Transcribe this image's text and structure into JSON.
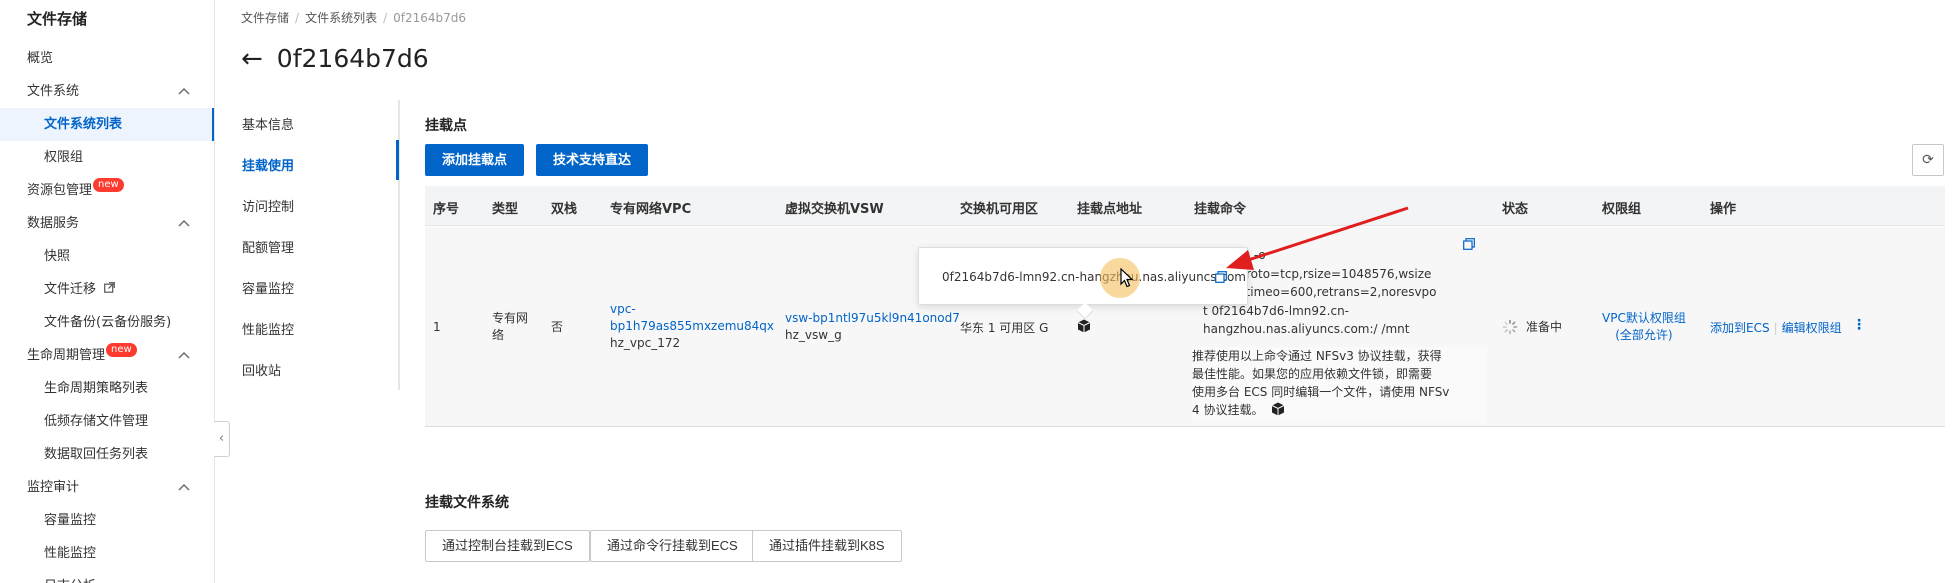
{
  "sidebar": {
    "title": "文件存储",
    "items": [
      {
        "label": "概览"
      },
      {
        "label": "文件系统"
      },
      {
        "label": "文件系统列表"
      },
      {
        "label": "权限组"
      },
      {
        "label": "资源包管理",
        "badge": "new"
      },
      {
        "label": "数据服务"
      },
      {
        "label": "快照"
      },
      {
        "label": "文件迁移"
      },
      {
        "label": "文件备份(云备份服务)"
      },
      {
        "label": "生命周期管理",
        "badge": "new"
      },
      {
        "label": "生命周期策略列表"
      },
      {
        "label": "低频存储文件管理"
      },
      {
        "label": "数据取回任务列表"
      },
      {
        "label": "监控审计"
      },
      {
        "label": "容量监控"
      },
      {
        "label": "性能监控"
      },
      {
        "label": "日志分析"
      }
    ],
    "collapse_glyph": "‹"
  },
  "breadcrumb": [
    "文件存储",
    "文件系统列表",
    "0f2164b7d6"
  ],
  "breadcrumb_sep": "/",
  "page": {
    "title": "0f2164b7d6",
    "back_glyph": "←"
  },
  "inner_nav": [
    {
      "label": "基本信息"
    },
    {
      "label": "挂载使用",
      "active": true
    },
    {
      "label": "访问控制"
    },
    {
      "label": "配额管理"
    },
    {
      "label": "容量监控"
    },
    {
      "label": "性能监控"
    },
    {
      "label": "回收站"
    }
  ],
  "mount": {
    "title": "挂载点",
    "add_button": "添加挂载点",
    "support_button": "技术支持直达",
    "refresh_glyph": "⟳",
    "columns": [
      "序号",
      "类型",
      "双栈",
      "专有网络VPC",
      "虚拟交换机VSW",
      "交换机可用区",
      "挂载点地址",
      "挂载命令",
      "状态",
      "权限组",
      "操作"
    ],
    "row": {
      "index": "1",
      "type_line1": "专有网",
      "type_line2": "络",
      "dual_stack": "否",
      "vpc_line1": "vpc-",
      "vpc_line2": "bp1h79as855mxzemu84qx",
      "vpc_name": "hz_vpc_172",
      "vsw": "vsw-bp1ntl97u5kl9n41onod7",
      "vsw_name": "hz_vsw_g",
      "zone": "华东 1 可用区 G",
      "cmd_lines": [
        "nt -t nfs -o",
        "olock,proto=tcp,rsize=1048576,wsize",
        "6,hard,timeo=600,retrans=2,noresvpo",
        "t 0f2164b7d6-lmn92.cn-",
        "hangzhou.nas.aliyuncs.com:/ /mnt"
      ],
      "note_lines": [
        "推荐使用以上命令通过 NFSv3 协议挂载，获得",
        "最佳性能。如果您的应用依赖文件锁，即需要",
        "使用多台 ECS 同时编辑一个文件，请使用 NFSv",
        "4 协议挂载。"
      ],
      "status": "准备中",
      "perm_line1": "VPC默认权限组",
      "perm_line2": "(全部允许)",
      "action_add_ecs": "添加到ECS",
      "action_edit": "编辑权限组",
      "action_sep": "|",
      "more_glyph": "⋮"
    },
    "tooltip_text": "0f2164b7d6-lmn92.cn-hangzhou.nas.aliyuncs.com"
  },
  "mount_fs": {
    "title": "挂载文件系统",
    "buttons": [
      "通过控制台挂载到ECS",
      "通过命令行挂载到ECS",
      "通过插件挂载到K8S"
    ]
  },
  "colors": {
    "primary": "#0064c8",
    "badge": "#ff3a2e",
    "arrow": "#e02020"
  }
}
